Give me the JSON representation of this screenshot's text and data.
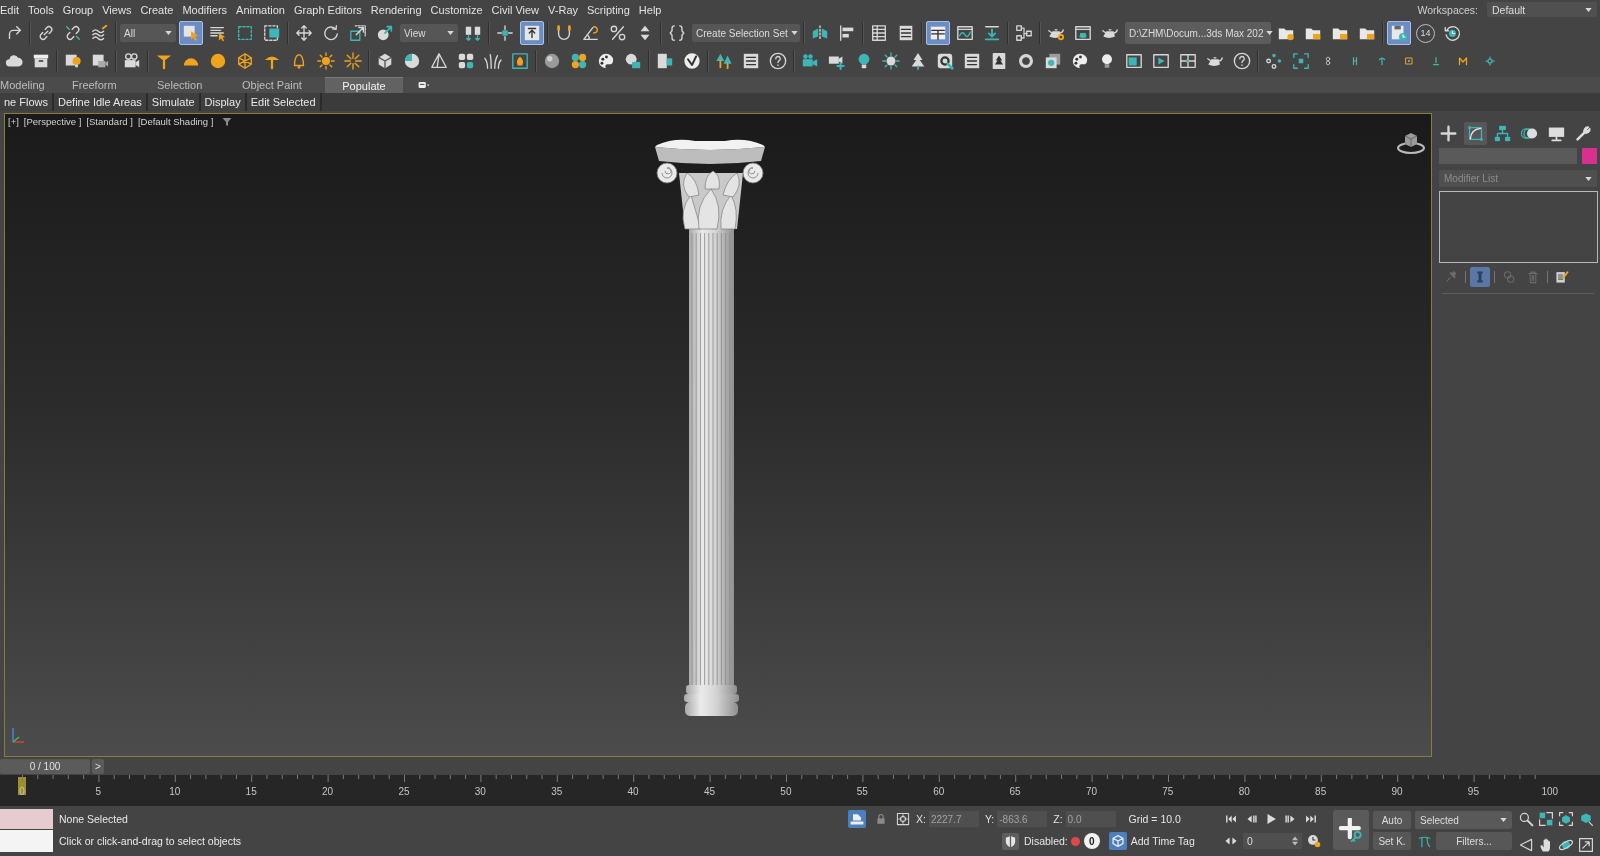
{
  "menu_bar": {
    "items": [
      "Edit",
      "Tools",
      "Group",
      "Views",
      "Create",
      "Modifiers",
      "Animation",
      "Graph Editors",
      "Rendering",
      "Customize",
      "Civil View",
      "V-Ray",
      "Scripting",
      "Help"
    ],
    "workspaces_label": "Workspaces:",
    "workspace": "Default"
  },
  "main_toolbar": [
    {
      "kind": "button",
      "selected": false
    },
    {
      "kind": "button",
      "selected": false
    },
    {
      "kind": "button",
      "selected": false
    },
    {
      "kind": "button",
      "selected": false
    },
    {
      "kind": "dropdown",
      "value": "All"
    },
    {
      "kind": "button",
      "selected": true
    },
    {
      "kind": "button",
      "selected": false
    },
    {
      "kind": "button",
      "selected": false
    },
    {
      "kind": "button",
      "selected": false
    },
    {
      "kind": "button",
      "selected": false
    },
    {
      "kind": "button",
      "selected": false
    },
    {
      "kind": "button",
      "selected": false
    },
    {
      "kind": "button",
      "selected": false
    },
    {
      "kind": "dropdown",
      "value": "View"
    },
    {
      "kind": "button",
      "selected": false
    },
    {
      "kind": "button",
      "selected": false
    },
    {
      "kind": "button",
      "selected": true
    },
    {
      "kind": "button",
      "selected": false
    },
    {
      "kind": "button",
      "selected": false
    },
    {
      "kind": "button",
      "selected": false
    },
    {
      "kind": "button",
      "selected": false
    },
    {
      "kind": "button",
      "selected": false
    },
    {
      "kind": "dropdown",
      "value": "Create Selection Set"
    },
    {
      "kind": "button",
      "selected": false
    },
    {
      "kind": "button",
      "selected": false
    },
    {
      "kind": "button",
      "selected": false
    },
    {
      "kind": "button",
      "selected": false
    },
    {
      "kind": "button",
      "selected": true
    },
    {
      "kind": "button",
      "selected": false
    },
    {
      "kind": "button",
      "selected": false
    },
    {
      "kind": "button",
      "selected": false
    },
    {
      "kind": "button",
      "selected": false
    },
    {
      "kind": "button",
      "selected": false
    },
    {
      "kind": "button",
      "selected": false
    },
    {
      "kind": "dropdown",
      "value": "D:\\ZHM\\Docum...3ds Max 202"
    },
    {
      "kind": "button",
      "selected": false
    },
    {
      "kind": "button",
      "selected": false
    },
    {
      "kind": "button",
      "selected": false
    },
    {
      "kind": "button",
      "selected": false
    },
    {
      "kind": "button",
      "selected": true
    },
    {
      "kind": "counter",
      "value": "14"
    },
    {
      "kind": "button",
      "selected": false
    }
  ],
  "ribbon": {
    "tabs": [
      {
        "label": "Modeling",
        "selected": false
      },
      {
        "label": "Freeform",
        "selected": false
      },
      {
        "label": "Selection",
        "selected": false
      },
      {
        "label": "Object Paint",
        "selected": false
      },
      {
        "label": "Populate",
        "selected": true
      }
    ],
    "panel_buttons": [
      "ne Flows",
      "Define Idle Areas",
      "Simulate",
      "Display",
      "Edit Selected"
    ]
  },
  "viewport": {
    "active": true,
    "labels": [
      "[+]",
      "[Perspective ]",
      "[Standard ]",
      "[Default Shading ]"
    ]
  },
  "command_panel": {
    "tabs": [
      {
        "selected": false
      },
      {
        "selected": true
      },
      {
        "selected": false
      },
      {
        "selected": false
      },
      {
        "selected": false
      },
      {
        "selected": false
      }
    ],
    "modifier_list": "Modifier List",
    "stack_buttons": [
      {
        "selected": false,
        "disabled": true
      },
      {
        "selected": true,
        "disabled": false
      },
      {
        "selected": false,
        "disabled": true
      },
      {
        "selected": false,
        "disabled": true
      },
      {
        "selected": false,
        "disabled": false
      }
    ]
  },
  "time_slider": {
    "label": "0 / 100",
    "level": 0,
    "next": ">"
  },
  "track_bar": {
    "ticks": [
      "0",
      "5",
      "10",
      "15",
      "20",
      "25",
      "30",
      "35",
      "40",
      "45",
      "50",
      "55",
      "60",
      "65",
      "70",
      "75",
      "80",
      "85",
      "90",
      "95",
      "100"
    ]
  },
  "status_bar": {
    "selection": "None Selected",
    "prompt": "Click or click-and-drag to select objects",
    "isolate": {
      "on": true
    },
    "selection_lock": {
      "on": false
    },
    "coordinates": [
      {
        "label": "X:",
        "value": "2227.7"
      },
      {
        "label": "Y:",
        "value": "-863.6"
      },
      {
        "label": "Z:",
        "value": "0.0"
      }
    ],
    "grid": "Grid = 10.0",
    "degradation_label": "Disabled:",
    "degradation_count": "0",
    "time_tag": "Add Time Tag"
  },
  "animation_controls": {
    "auto_key": {
      "label": "Auto",
      "on": false
    },
    "set_key": "Set K.",
    "key_filter": "Selected",
    "filters": "Filters...",
    "current_frame": "0"
  }
}
